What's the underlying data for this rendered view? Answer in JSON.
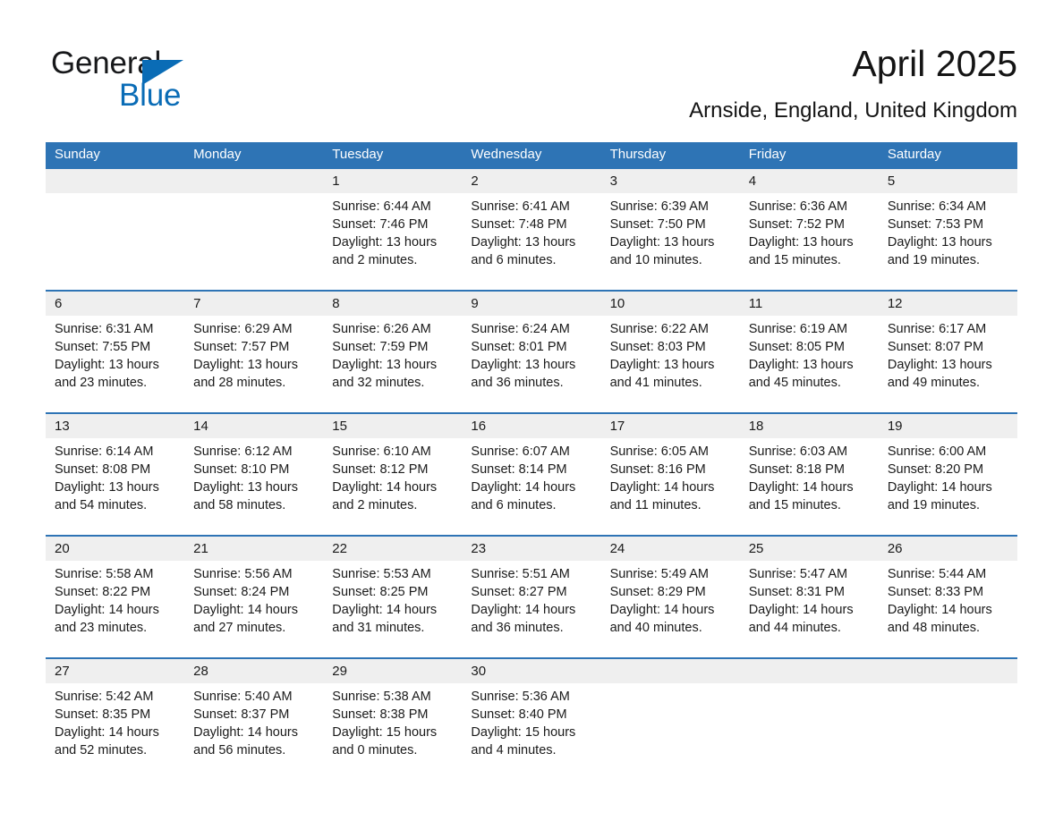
{
  "brand": {
    "name_part1": "General",
    "name_part2": "Blue",
    "triangle_color": "#0A6CB6",
    "text_color": "#17181a"
  },
  "header": {
    "title": "April 2025",
    "location": "Arnside, England, United Kingdom"
  },
  "theme": {
    "header_band": "#2E74B5",
    "date_band": "#EFEFEF",
    "row_rule": "#2E74B5",
    "text": "#1a1a1a",
    "background": "#ffffff"
  },
  "weekday_headers": [
    "Sunday",
    "Monday",
    "Tuesday",
    "Wednesday",
    "Thursday",
    "Friday",
    "Saturday"
  ],
  "weeks": [
    {
      "days": [
        {
          "num": "",
          "lines": [
            "",
            "",
            "",
            ""
          ]
        },
        {
          "num": "",
          "lines": [
            "",
            "",
            "",
            ""
          ]
        },
        {
          "num": "1",
          "lines": [
            "Sunrise: 6:44 AM",
            "Sunset: 7:46 PM",
            "Daylight: 13 hours",
            "and 2 minutes."
          ]
        },
        {
          "num": "2",
          "lines": [
            "Sunrise: 6:41 AM",
            "Sunset: 7:48 PM",
            "Daylight: 13 hours",
            "and 6 minutes."
          ]
        },
        {
          "num": "3",
          "lines": [
            "Sunrise: 6:39 AM",
            "Sunset: 7:50 PM",
            "Daylight: 13 hours",
            "and 10 minutes."
          ]
        },
        {
          "num": "4",
          "lines": [
            "Sunrise: 6:36 AM",
            "Sunset: 7:52 PM",
            "Daylight: 13 hours",
            "and 15 minutes."
          ]
        },
        {
          "num": "5",
          "lines": [
            "Sunrise: 6:34 AM",
            "Sunset: 7:53 PM",
            "Daylight: 13 hours",
            "and 19 minutes."
          ]
        }
      ]
    },
    {
      "days": [
        {
          "num": "6",
          "lines": [
            "Sunrise: 6:31 AM",
            "Sunset: 7:55 PM",
            "Daylight: 13 hours",
            "and 23 minutes."
          ]
        },
        {
          "num": "7",
          "lines": [
            "Sunrise: 6:29 AM",
            "Sunset: 7:57 PM",
            "Daylight: 13 hours",
            "and 28 minutes."
          ]
        },
        {
          "num": "8",
          "lines": [
            "Sunrise: 6:26 AM",
            "Sunset: 7:59 PM",
            "Daylight: 13 hours",
            "and 32 minutes."
          ]
        },
        {
          "num": "9",
          "lines": [
            "Sunrise: 6:24 AM",
            "Sunset: 8:01 PM",
            "Daylight: 13 hours",
            "and 36 minutes."
          ]
        },
        {
          "num": "10",
          "lines": [
            "Sunrise: 6:22 AM",
            "Sunset: 8:03 PM",
            "Daylight: 13 hours",
            "and 41 minutes."
          ]
        },
        {
          "num": "11",
          "lines": [
            "Sunrise: 6:19 AM",
            "Sunset: 8:05 PM",
            "Daylight: 13 hours",
            "and 45 minutes."
          ]
        },
        {
          "num": "12",
          "lines": [
            "Sunrise: 6:17 AM",
            "Sunset: 8:07 PM",
            "Daylight: 13 hours",
            "and 49 minutes."
          ]
        }
      ]
    },
    {
      "days": [
        {
          "num": "13",
          "lines": [
            "Sunrise: 6:14 AM",
            "Sunset: 8:08 PM",
            "Daylight: 13 hours",
            "and 54 minutes."
          ]
        },
        {
          "num": "14",
          "lines": [
            "Sunrise: 6:12 AM",
            "Sunset: 8:10 PM",
            "Daylight: 13 hours",
            "and 58 minutes."
          ]
        },
        {
          "num": "15",
          "lines": [
            "Sunrise: 6:10 AM",
            "Sunset: 8:12 PM",
            "Daylight: 14 hours",
            "and 2 minutes."
          ]
        },
        {
          "num": "16",
          "lines": [
            "Sunrise: 6:07 AM",
            "Sunset: 8:14 PM",
            "Daylight: 14 hours",
            "and 6 minutes."
          ]
        },
        {
          "num": "17",
          "lines": [
            "Sunrise: 6:05 AM",
            "Sunset: 8:16 PM",
            "Daylight: 14 hours",
            "and 11 minutes."
          ]
        },
        {
          "num": "18",
          "lines": [
            "Sunrise: 6:03 AM",
            "Sunset: 8:18 PM",
            "Daylight: 14 hours",
            "and 15 minutes."
          ]
        },
        {
          "num": "19",
          "lines": [
            "Sunrise: 6:00 AM",
            "Sunset: 8:20 PM",
            "Daylight: 14 hours",
            "and 19 minutes."
          ]
        }
      ]
    },
    {
      "days": [
        {
          "num": "20",
          "lines": [
            "Sunrise: 5:58 AM",
            "Sunset: 8:22 PM",
            "Daylight: 14 hours",
            "and 23 minutes."
          ]
        },
        {
          "num": "21",
          "lines": [
            "Sunrise: 5:56 AM",
            "Sunset: 8:24 PM",
            "Daylight: 14 hours",
            "and 27 minutes."
          ]
        },
        {
          "num": "22",
          "lines": [
            "Sunrise: 5:53 AM",
            "Sunset: 8:25 PM",
            "Daylight: 14 hours",
            "and 31 minutes."
          ]
        },
        {
          "num": "23",
          "lines": [
            "Sunrise: 5:51 AM",
            "Sunset: 8:27 PM",
            "Daylight: 14 hours",
            "and 36 minutes."
          ]
        },
        {
          "num": "24",
          "lines": [
            "Sunrise: 5:49 AM",
            "Sunset: 8:29 PM",
            "Daylight: 14 hours",
            "and 40 minutes."
          ]
        },
        {
          "num": "25",
          "lines": [
            "Sunrise: 5:47 AM",
            "Sunset: 8:31 PM",
            "Daylight: 14 hours",
            "and 44 minutes."
          ]
        },
        {
          "num": "26",
          "lines": [
            "Sunrise: 5:44 AM",
            "Sunset: 8:33 PM",
            "Daylight: 14 hours",
            "and 48 minutes."
          ]
        }
      ]
    },
    {
      "days": [
        {
          "num": "27",
          "lines": [
            "Sunrise: 5:42 AM",
            "Sunset: 8:35 PM",
            "Daylight: 14 hours",
            "and 52 minutes."
          ]
        },
        {
          "num": "28",
          "lines": [
            "Sunrise: 5:40 AM",
            "Sunset: 8:37 PM",
            "Daylight: 14 hours",
            "and 56 minutes."
          ]
        },
        {
          "num": "29",
          "lines": [
            "Sunrise: 5:38 AM",
            "Sunset: 8:38 PM",
            "Daylight: 15 hours",
            "and 0 minutes."
          ]
        },
        {
          "num": "30",
          "lines": [
            "Sunrise: 5:36 AM",
            "Sunset: 8:40 PM",
            "Daylight: 15 hours",
            "and 4 minutes."
          ]
        },
        {
          "num": "",
          "lines": [
            "",
            "",
            "",
            ""
          ]
        },
        {
          "num": "",
          "lines": [
            "",
            "",
            "",
            ""
          ]
        },
        {
          "num": "",
          "lines": [
            "",
            "",
            "",
            ""
          ]
        }
      ]
    }
  ]
}
